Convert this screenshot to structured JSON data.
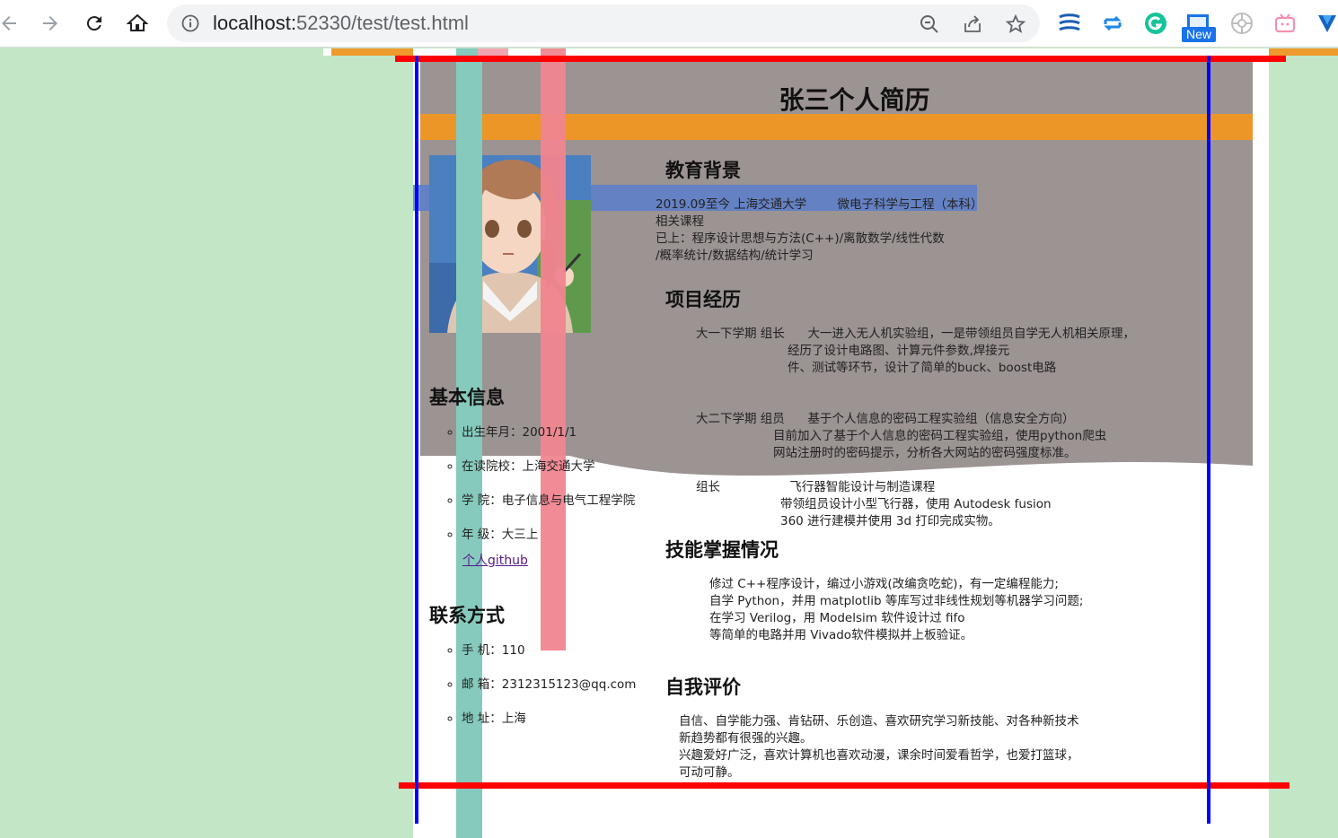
{
  "browser": {
    "url_host": "localhost:",
    "url_port_path": "52330/test/test.html",
    "new_badge": "New"
  },
  "resume": {
    "title": "张三个人简历",
    "education": {
      "heading": "教育背景",
      "line1": "2019.09至今 上海交通大学        微电子科学与工程（本科）",
      "line2": "相关课程",
      "line3": "已上：程序设计思想与方法(C++)/离散数学/线性代数",
      "line4": "/概率统计/数据结构/统计学习"
    },
    "projects": {
      "heading": "项目经历",
      "p1_line1": "大一下学期 组长      大一进入无人机实验组，一是带领组员自学无人机相关原理，",
      "p1_line2": "经历了设计电路图、计算元件参数,焊接元",
      "p1_line3": "件、测试等环节，设计了简单的buck、boost电路",
      "p2_line1": "大二下学期 组员      基于个人信息的密码工程实验组（信息安全方向）",
      "p2_line2": "目前加入了基于个人信息的密码工程实验组，使用python爬虫",
      "p2_line3": "网站注册时的密码提示，分析各大网站的密码强度标准。",
      "p3_line1": "组长                  飞行器智能设计与制造课程",
      "p3_line2": "带领组员设计小型飞行器，使用 Autodesk fusion",
      "p3_line3": "360 进行建模并使用 3d 打印完成实物。"
    },
    "skills": {
      "heading": "技能掌握情况",
      "line1": "修过 C++程序设计，编过小游戏(改编贪吃蛇)，有一定编程能力;",
      "line2": "自学 Python，并用 matplotlib 等库写过非线性规划等机器学习问题;",
      "line3": "在学习 Verilog，用 Modelsim 软件设计过 fifo",
      "line4": "等简单的电路并用 Vivado软件模拟并上板验证。"
    },
    "self_eval": {
      "heading": "自我评价",
      "line1": "自信、自学能力强、肯钻研、乐创造、喜欢研究学习新技能、对各种新技术",
      "line2": "新趋势都有很强的兴趣。",
      "line3": "兴趣爱好广泛，喜欢计算机也喜欢动漫，课余时间爱看哲学，也爱打篮球，",
      "line4": "可动可静。"
    },
    "basic_info": {
      "heading": "基本信息",
      "items": [
        "出生年月：2001/1/1",
        "在读院校：上海交通大学",
        "学  院：电子信息与电气工程学院",
        "年  级：大三上"
      ],
      "github_link": "个人github"
    },
    "contact": {
      "heading": "联系方式",
      "items": [
        "手  机：110",
        "邮  箱：2312315123@qq.com",
        "地  址：上海"
      ]
    }
  },
  "colors": {
    "desktop_bg": "#c2e6c6",
    "gray_band": "#9c9393",
    "orange": "#ec9628",
    "teal": "#85cabc",
    "pink": "#f0858f",
    "blue_strip": "#5b7ecb",
    "red_line": "#ff0000",
    "blue_line": "#0000ff"
  }
}
